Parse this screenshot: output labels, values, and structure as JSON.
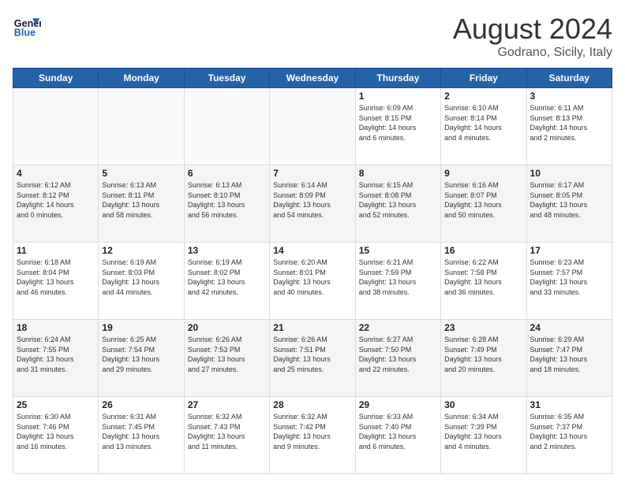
{
  "logo": {
    "line1": "General",
    "line2": "Blue"
  },
  "header": {
    "month": "August 2024",
    "location": "Godrano, Sicily, Italy"
  },
  "weekdays": [
    "Sunday",
    "Monday",
    "Tuesday",
    "Wednesday",
    "Thursday",
    "Friday",
    "Saturday"
  ],
  "weeks": [
    [
      {
        "day": "",
        "info": ""
      },
      {
        "day": "",
        "info": ""
      },
      {
        "day": "",
        "info": ""
      },
      {
        "day": "",
        "info": ""
      },
      {
        "day": "1",
        "info": "Sunrise: 6:09 AM\nSunset: 8:15 PM\nDaylight: 14 hours\nand 6 minutes."
      },
      {
        "day": "2",
        "info": "Sunrise: 6:10 AM\nSunset: 8:14 PM\nDaylight: 14 hours\nand 4 minutes."
      },
      {
        "day": "3",
        "info": "Sunrise: 6:11 AM\nSunset: 8:13 PM\nDaylight: 14 hours\nand 2 minutes."
      }
    ],
    [
      {
        "day": "4",
        "info": "Sunrise: 6:12 AM\nSunset: 8:12 PM\nDaylight: 14 hours\nand 0 minutes."
      },
      {
        "day": "5",
        "info": "Sunrise: 6:13 AM\nSunset: 8:11 PM\nDaylight: 13 hours\nand 58 minutes."
      },
      {
        "day": "6",
        "info": "Sunrise: 6:13 AM\nSunset: 8:10 PM\nDaylight: 13 hours\nand 56 minutes."
      },
      {
        "day": "7",
        "info": "Sunrise: 6:14 AM\nSunset: 8:09 PM\nDaylight: 13 hours\nand 54 minutes."
      },
      {
        "day": "8",
        "info": "Sunrise: 6:15 AM\nSunset: 8:08 PM\nDaylight: 13 hours\nand 52 minutes."
      },
      {
        "day": "9",
        "info": "Sunrise: 6:16 AM\nSunset: 8:07 PM\nDaylight: 13 hours\nand 50 minutes."
      },
      {
        "day": "10",
        "info": "Sunrise: 6:17 AM\nSunset: 8:05 PM\nDaylight: 13 hours\nand 48 minutes."
      }
    ],
    [
      {
        "day": "11",
        "info": "Sunrise: 6:18 AM\nSunset: 8:04 PM\nDaylight: 13 hours\nand 46 minutes."
      },
      {
        "day": "12",
        "info": "Sunrise: 6:19 AM\nSunset: 8:03 PM\nDaylight: 13 hours\nand 44 minutes."
      },
      {
        "day": "13",
        "info": "Sunrise: 6:19 AM\nSunset: 8:02 PM\nDaylight: 13 hours\nand 42 minutes."
      },
      {
        "day": "14",
        "info": "Sunrise: 6:20 AM\nSunset: 8:01 PM\nDaylight: 13 hours\nand 40 minutes."
      },
      {
        "day": "15",
        "info": "Sunrise: 6:21 AM\nSunset: 7:59 PM\nDaylight: 13 hours\nand 38 minutes."
      },
      {
        "day": "16",
        "info": "Sunrise: 6:22 AM\nSunset: 7:58 PM\nDaylight: 13 hours\nand 36 minutes."
      },
      {
        "day": "17",
        "info": "Sunrise: 6:23 AM\nSunset: 7:57 PM\nDaylight: 13 hours\nand 33 minutes."
      }
    ],
    [
      {
        "day": "18",
        "info": "Sunrise: 6:24 AM\nSunset: 7:55 PM\nDaylight: 13 hours\nand 31 minutes."
      },
      {
        "day": "19",
        "info": "Sunrise: 6:25 AM\nSunset: 7:54 PM\nDaylight: 13 hours\nand 29 minutes."
      },
      {
        "day": "20",
        "info": "Sunrise: 6:26 AM\nSunset: 7:53 PM\nDaylight: 13 hours\nand 27 minutes."
      },
      {
        "day": "21",
        "info": "Sunrise: 6:26 AM\nSunset: 7:51 PM\nDaylight: 13 hours\nand 25 minutes."
      },
      {
        "day": "22",
        "info": "Sunrise: 6:27 AM\nSunset: 7:50 PM\nDaylight: 13 hours\nand 22 minutes."
      },
      {
        "day": "23",
        "info": "Sunrise: 6:28 AM\nSunset: 7:49 PM\nDaylight: 13 hours\nand 20 minutes."
      },
      {
        "day": "24",
        "info": "Sunrise: 6:29 AM\nSunset: 7:47 PM\nDaylight: 13 hours\nand 18 minutes."
      }
    ],
    [
      {
        "day": "25",
        "info": "Sunrise: 6:30 AM\nSunset: 7:46 PM\nDaylight: 13 hours\nand 16 minutes."
      },
      {
        "day": "26",
        "info": "Sunrise: 6:31 AM\nSunset: 7:45 PM\nDaylight: 13 hours\nand 13 minutes."
      },
      {
        "day": "27",
        "info": "Sunrise: 6:32 AM\nSunset: 7:43 PM\nDaylight: 13 hours\nand 11 minutes."
      },
      {
        "day": "28",
        "info": "Sunrise: 6:32 AM\nSunset: 7:42 PM\nDaylight: 13 hours\nand 9 minutes."
      },
      {
        "day": "29",
        "info": "Sunrise: 6:33 AM\nSunset: 7:40 PM\nDaylight: 13 hours\nand 6 minutes."
      },
      {
        "day": "30",
        "info": "Sunrise: 6:34 AM\nSunset: 7:39 PM\nDaylight: 13 hours\nand 4 minutes."
      },
      {
        "day": "31",
        "info": "Sunrise: 6:35 AM\nSunset: 7:37 PM\nDaylight: 13 hours\nand 2 minutes."
      }
    ]
  ]
}
